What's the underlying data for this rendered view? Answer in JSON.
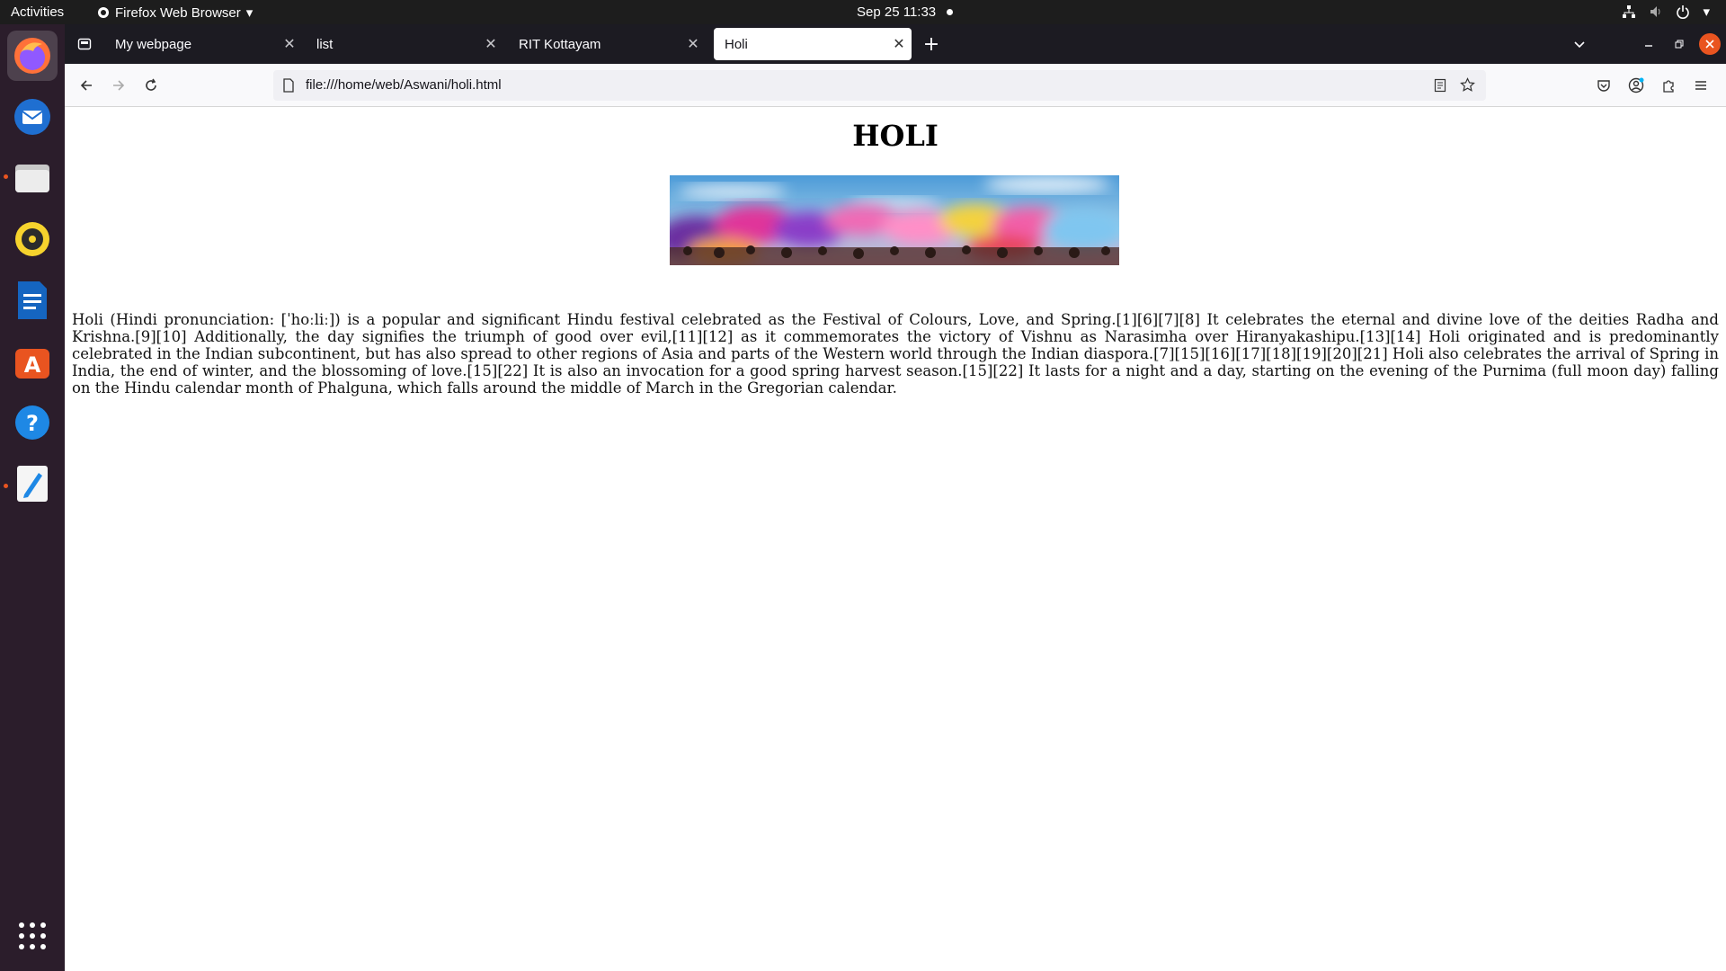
{
  "topbar": {
    "activities": "Activities",
    "app_name": "Firefox Web Browser",
    "clock": "Sep 25  11:33"
  },
  "dock": {
    "items": [
      {
        "icon": "firefox-icon",
        "active": true,
        "running": true
      },
      {
        "icon": "thunderbird-icon",
        "active": false,
        "running": false
      },
      {
        "icon": "files-icon",
        "active": false,
        "running": true
      },
      {
        "icon": "rhythmbox-icon",
        "active": false,
        "running": false
      },
      {
        "icon": "libreoffice-writer-icon",
        "active": false,
        "running": false
      },
      {
        "icon": "app-center-icon",
        "active": false,
        "running": false
      },
      {
        "icon": "help-icon",
        "active": false,
        "running": false
      },
      {
        "icon": "text-editor-icon",
        "active": false,
        "running": true
      },
      {
        "icon": "app-grid-icon",
        "active": false,
        "running": false
      }
    ]
  },
  "browser": {
    "tabs": [
      {
        "title": "My webpage",
        "selected": false
      },
      {
        "title": "list",
        "selected": false
      },
      {
        "title": "RIT Kottayam",
        "selected": false
      },
      {
        "title": "Holi",
        "selected": true
      }
    ],
    "url": "file:///home/web/Aswani/holi.html"
  },
  "page": {
    "heading": "HOLI",
    "paragraph": "Holi (Hindi pronunciation: [ˈhoːliː]) is a popular and significant Hindu festival celebrated as the Festival of Colours, Love, and Spring.[1][6][7][8] It celebrates the eternal and divine love of the deities Radha and Krishna.[9][10] Additionally, the day signifies the triumph of good over evil,[11][12] as it commemorates the victory of Vishnu as Narasimha over Hiranyakashipu.[13][14] Holi originated and is predominantly celebrated in the Indian subcontinent, but has also spread to other regions of Asia and parts of the Western world through the Indian diaspora.[7][15][16][17][18][19][20][21] Holi also celebrates the arrival of Spring in India, the end of winter, and the blossoming of love.[15][22] It is also an invocation for a good spring harvest season.[15][22] It lasts for a night and a day, starting on the evening of the Purnima (full moon day) falling on the Hindu calendar month of Phalguna, which falls around the middle of March in the Gregorian calendar."
  },
  "colors": {
    "topbar": "#1d1d1d",
    "dock": "#2b1d2b",
    "tabbar": "#1c1b22",
    "accent": "#e95420"
  }
}
